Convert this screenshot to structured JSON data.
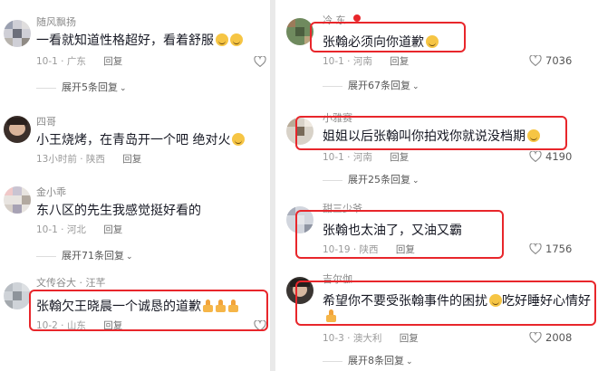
{
  "left_panel": {
    "comments": [
      {
        "username": "随风飘扬",
        "content": "一看就知道性格超好，看着舒服",
        "emoji": [
          "smile",
          "smile"
        ],
        "date": "10-1",
        "location": "广东",
        "reply_label": "回复",
        "expand_label": "展开5条回复",
        "like_count": ""
      },
      {
        "username": "四哥",
        "content": "小王烧烤，在青岛开一个吧 绝对火",
        "emoji": [
          "grin"
        ],
        "date": "13小时前",
        "location": "陕西",
        "reply_label": "回复",
        "expand_label": "",
        "like_count": ""
      },
      {
        "username": "金小乖",
        "content": "东八区的先生我感觉挺好看的",
        "emoji": [],
        "date": "10-1",
        "location": "河北",
        "reply_label": "回复",
        "expand_label": "展开71条回复",
        "like_count": ""
      },
      {
        "username": "文传谷大 · 汪芊",
        "content": "张翰欠王晓晨一个诚恳的道歉",
        "emoji": [
          "thumbs",
          "thumbs",
          "thumbs"
        ],
        "date": "10-2",
        "location": "山东",
        "reply_label": "回复",
        "expand_label": "",
        "like_count": ""
      }
    ]
  },
  "right_panel": {
    "comments": [
      {
        "username": "冷 东",
        "content": "张翰必须向你道歉",
        "emoji": [
          "smile"
        ],
        "date": "10-1",
        "location": "河南",
        "reply_label": "回复",
        "expand_label": "展开67条回复",
        "like_count": "7036"
      },
      {
        "username": "小雅赛",
        "content": "姐姐以后张翰叫你拍戏你就说没档期",
        "emoji": [
          "laugh"
        ],
        "date": "10-1",
        "location": "河南",
        "reply_label": "回复",
        "expand_label": "展开25条回复",
        "like_count": "4190"
      },
      {
        "username": "甜三少爷",
        "content": "张翰也太油了，又油又霸",
        "emoji": [],
        "date": "10-19",
        "location": "陕西",
        "reply_label": "回复",
        "expand_label": "",
        "like_count": "1756"
      },
      {
        "username": "吉尔伽",
        "content": "希望你不要受张翰事件的困扰",
        "content_tail": "吃好睡好心情好",
        "emoji": [
          "smile"
        ],
        "date": "10-3",
        "location": "澳大利",
        "reply_label": "回复",
        "expand_label": "展开8条回复",
        "like_count": "2008"
      }
    ]
  },
  "colors": {
    "highlight_box": "#e8262b",
    "text_primary": "#161823",
    "text_secondary": "#9a9a9a"
  },
  "icons": {
    "like": "heart-outline-icon",
    "expand": "chevron-down-icon"
  }
}
